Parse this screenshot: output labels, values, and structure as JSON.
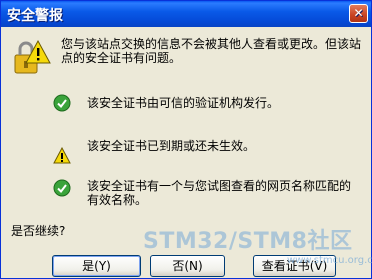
{
  "window": {
    "title": "安全警报",
    "close_symbol": "✕"
  },
  "header": {
    "text": "您与该站点交换的信息不会被其他人查看或更改。但该站点的安全证书有问题。",
    "icon": "lock-warning-icon"
  },
  "rows": [
    {
      "icon": "check-circle-icon",
      "text": "该安全证书由可信的验证机构发行。"
    },
    {
      "icon": "warning-triangle-icon",
      "text": "该安全证书已到期或还未生效。"
    },
    {
      "icon": "check-circle-icon",
      "text": "该安全证书有一个与您试图查看的网页名称匹配的有效名称。"
    }
  ],
  "question": "是否继续?",
  "buttons": {
    "yes": "是(Y)",
    "no": "否(N)",
    "view": "查看证书(V)"
  },
  "watermark": {
    "text": "STM32/STM8社区",
    "sub": "www.stmcu.org.cn"
  },
  "colors": {
    "title_bar": "#0a5ae8",
    "window_bg": "#ece9d8",
    "check_green": "#3aa33a",
    "warning_yellow": "#f5d90a"
  }
}
